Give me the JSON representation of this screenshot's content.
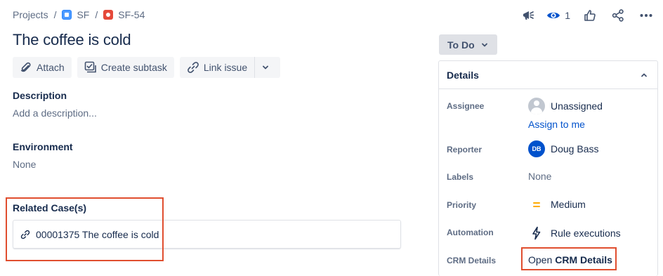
{
  "breadcrumb": {
    "projects": "Projects",
    "separator": "/",
    "project": "SF",
    "issue_key": "SF-54"
  },
  "top_actions": {
    "watch_count": "1"
  },
  "issue": {
    "title": "The coffee is cold"
  },
  "toolbar": {
    "attach": "Attach",
    "create_subtask": "Create subtask",
    "link_issue": "Link issue"
  },
  "description": {
    "label": "Description",
    "placeholder": "Add a description..."
  },
  "environment": {
    "label": "Environment",
    "value": "None"
  },
  "related_cases": {
    "label": "Related Case(s)",
    "items": [
      {
        "text": "00001375 The coffee is cold"
      }
    ]
  },
  "status": {
    "label": "To Do"
  },
  "details": {
    "title": "Details",
    "assignee": {
      "label": "Assignee",
      "value": "Unassigned",
      "action": "Assign to me"
    },
    "reporter": {
      "label": "Reporter",
      "initials": "DB",
      "value": "Doug Bass"
    },
    "labels": {
      "label": "Labels",
      "value": "None"
    },
    "priority": {
      "label": "Priority",
      "value": "Medium"
    },
    "automation": {
      "label": "Automation",
      "value": "Rule executions"
    },
    "crm": {
      "label": "CRM Details",
      "prefix": "Open",
      "bold": "CRM Details"
    }
  },
  "colors": {
    "accent": "#0052cc",
    "highlight": "#e04e2f",
    "priority_medium": "#ffab00"
  }
}
